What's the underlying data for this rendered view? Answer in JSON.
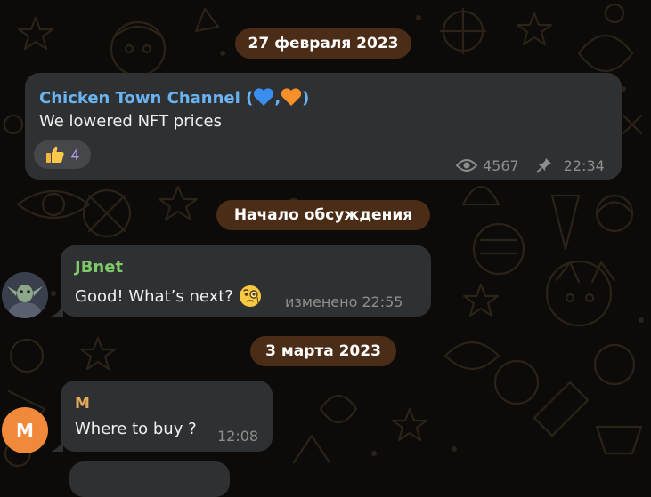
{
  "dates": {
    "first": "27 февраля 2023",
    "discussion_start": "Начало обсуждения",
    "second": "3 марта 2023"
  },
  "channel_post": {
    "author": "Chicken Town Channel",
    "author_open": "(",
    "author_sep": ",",
    "author_close": ")",
    "text": "We lowered NFT prices",
    "reaction_emoji": "thumbs-up",
    "reaction_count": "4",
    "views": "4567",
    "time": "22:34"
  },
  "messages": [
    {
      "author": "JBnet",
      "text": "Good! What’s next?",
      "edited_label": "изменено",
      "time": "22:55"
    },
    {
      "author": "M",
      "avatar_letter": "M",
      "text": "Where to buy ?",
      "time": "12:08"
    }
  ],
  "colors": {
    "bubble": "#2e3031",
    "date_pill": "#4a2c17",
    "channel_author": "#6ab3f3",
    "jbnet_author": "#7ec96a",
    "m_author": "#e4a95c",
    "m_avatar": "#f08a3a"
  }
}
